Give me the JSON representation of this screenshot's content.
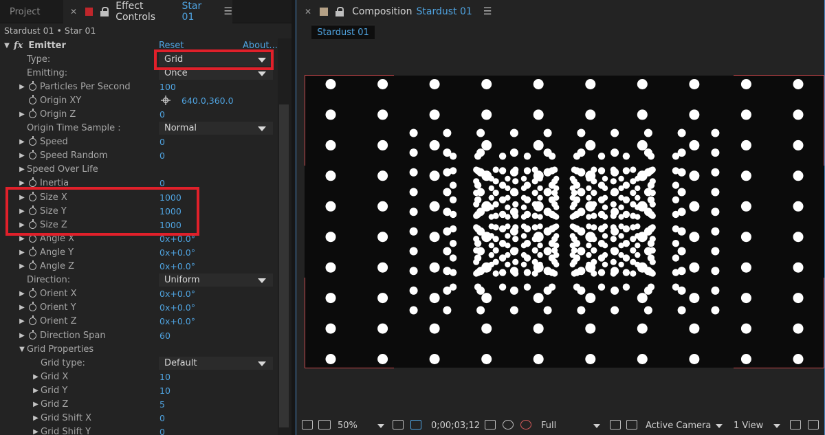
{
  "left_panel": {
    "tabs": {
      "project": "Project",
      "effect_controls": "Effect Controls",
      "effect_layer": "Star 01"
    },
    "breadcrumb": "Stardust 01 • Star 01",
    "emitter": {
      "label": "Emitter",
      "reset": "Reset",
      "about": "About..."
    },
    "rows": [
      {
        "label": "Type:",
        "dropdown": "Grid"
      },
      {
        "label": "Emitting:",
        "dropdown": "Once"
      },
      {
        "label": "Particles Per Second",
        "value": "100"
      },
      {
        "label": "Origin XY",
        "value": "640.0,360.0"
      },
      {
        "label": "Origin Z",
        "value": "0"
      },
      {
        "label": "Origin Time Sample :",
        "dropdown": "Normal"
      },
      {
        "label": "Speed",
        "value": "0"
      },
      {
        "label": "Speed Random",
        "value": "0"
      },
      {
        "label": "Speed Over Life"
      },
      {
        "label": "Inertia",
        "value": "0"
      },
      {
        "label": "Size X",
        "value": "1000"
      },
      {
        "label": "Size Y",
        "value": "1000"
      },
      {
        "label": "Size Z",
        "value": "1000"
      },
      {
        "label": "Angle X",
        "value": "0x+0.0°"
      },
      {
        "label": "Angle Y",
        "value": "0x+0.0°"
      },
      {
        "label": "Angle Z",
        "value": "0x+0.0°"
      },
      {
        "label": "Direction:",
        "dropdown": "Uniform"
      },
      {
        "label": "Orient X",
        "value": "0x+0.0°"
      },
      {
        "label": "Orient Y",
        "value": "0x+0.0°"
      },
      {
        "label": "Orient Z",
        "value": "0x+0.0°"
      },
      {
        "label": "Direction Span",
        "value": "60"
      },
      {
        "label": "Grid Properties"
      },
      {
        "label": "Grid type:",
        "dropdown": "Default"
      },
      {
        "label": "Grid X",
        "value": "10"
      },
      {
        "label": "Grid Y",
        "value": "10"
      },
      {
        "label": "Grid Z",
        "value": "5"
      },
      {
        "label": "Grid Shift X",
        "value": "0"
      },
      {
        "label": "Grid Shift Y",
        "value": "0"
      }
    ]
  },
  "right_panel": {
    "tab_title": "Composition",
    "tab_sub": "Stardust 01",
    "comp_tab": "Stardust 01",
    "bottom_bar": {
      "zoom": "50%",
      "timecode": "0;00;03;12",
      "resolution": "Full",
      "camera": "Active Camera",
      "views": "1 View"
    }
  },
  "colors": {
    "accent_blue": "#4fa3e0",
    "highlight_red": "#e0202a",
    "frame_red": "#c9494d"
  }
}
